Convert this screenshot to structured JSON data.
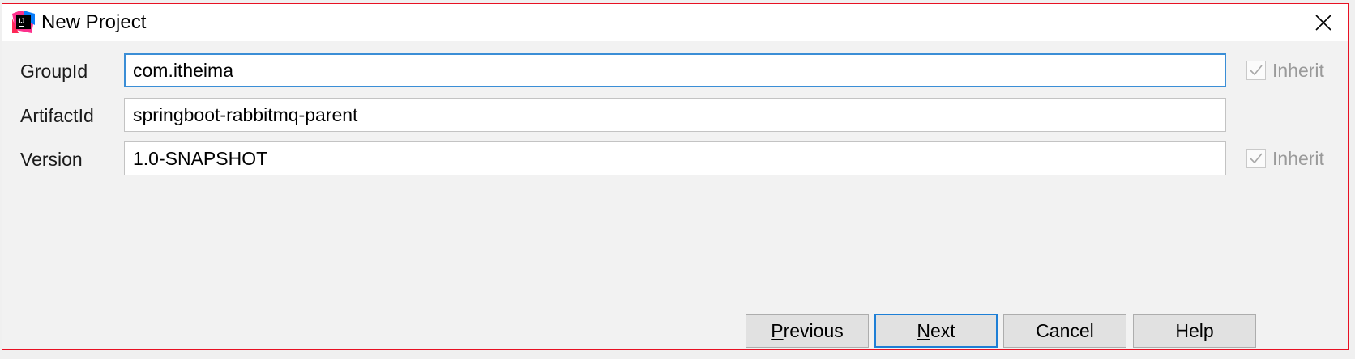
{
  "window": {
    "title": "New Project",
    "app_icon_text": "IJ"
  },
  "fields": [
    {
      "label": "GroupId",
      "value": "com.itheima",
      "focused": true,
      "inherit": true,
      "inherit_label": "Inherit"
    },
    {
      "label": "ArtifactId",
      "value": "springboot-rabbitmq-parent",
      "focused": false,
      "inherit": false
    },
    {
      "label": "Version",
      "value": "1.0-SNAPSHOT",
      "focused": false,
      "inherit": true,
      "inherit_label": "Inherit"
    }
  ],
  "buttons": {
    "previous": {
      "mnemonic": "P",
      "rest": "revious"
    },
    "next": {
      "mnemonic": "N",
      "rest": "ext"
    },
    "cancel": "Cancel",
    "help": "Help"
  },
  "colors": {
    "window_border": "#e81123",
    "focus": "#3b8ed6",
    "default_button_border": "#1e7fd6"
  }
}
